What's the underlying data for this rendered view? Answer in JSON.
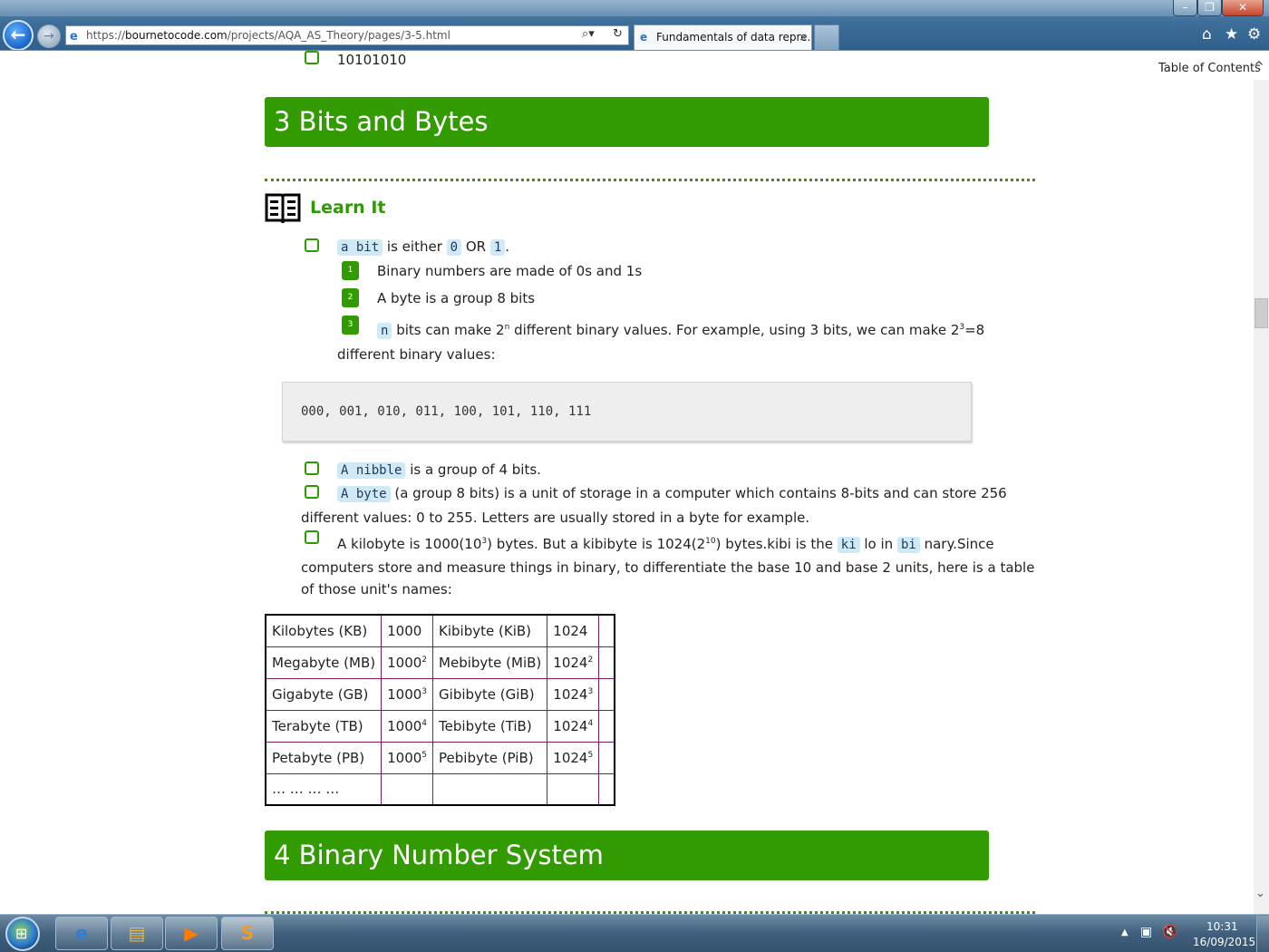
{
  "browser": {
    "url_prefix": "https://",
    "url_host": "bournetocode.com",
    "url_path": "/projects/AQA_AS_Theory/pages/3-5.html",
    "tab_title": "Fundamentals of data repre...",
    "tab_close": "×"
  },
  "page": {
    "toc_link": "Table of Contents",
    "prev_item": "10101010",
    "section3_title": "3 Bits and Bytes",
    "learn_title": "Learn It",
    "bit": {
      "code_bit": "a bit",
      "text_is_either": " is either ",
      "code_zero": "0",
      "text_or": " OR ",
      "code_one": "1",
      "text_dot": "."
    },
    "numbered": [
      {
        "badge": "1",
        "text": "Binary numbers are made of 0s and 1s"
      },
      {
        "badge": "2",
        "text": "A byte is a group 8 bits"
      },
      {
        "badge": "3",
        "code": "n",
        "text_a": " bits can make 2",
        "sup_n": "n",
        "text_b": " different binary values. For example, using 3 bits, we can make 2",
        "sup_3": "3",
        "text_c": "=8",
        "text_d": "different binary values:"
      }
    ],
    "code_block": "000, 001, 010, 011, 100, 101, 110, 111",
    "nibble": {
      "code": "A nibble",
      "text": " is a group of 4 bits."
    },
    "byte": {
      "code": "A byte",
      "text_a": " (a group 8 bits) is a unit of storage in a computer which contains 8-bits and can store 256",
      "text_b": "different values: 0 to 255. Letters are usually stored in a byte for example."
    },
    "kilobyte": {
      "text_a": "A kilobyte is 1000(10",
      "sup_a": "3",
      "text_b": ") bytes. But a kibibyte is 1024(2",
      "sup_b": "10",
      "text_c": ") bytes.kibi is the ",
      "code_ki": "ki",
      "text_d": " lo in ",
      "code_bi": "bi",
      "text_e": " nary.Since",
      "line2": "computers store and measure things in binary, to differentiate the base 10 and base 2 units, here is a table",
      "line3": "of those unit's names:"
    },
    "table_rows": [
      [
        "Kilobytes (KB)",
        "1000",
        "",
        "Kibibyte (KiB)",
        "1024",
        ""
      ],
      [
        "Megabyte (MB)",
        "1000",
        "2",
        "Mebibyte (MiB)",
        "1024",
        "2"
      ],
      [
        "Gigabyte (GB)",
        "1000",
        "3",
        "Gibibyte (GiB)",
        "1024",
        "3"
      ],
      [
        "Terabyte (TB)",
        "1000",
        "4",
        "Tebibyte (TiB)",
        "1024",
        "4"
      ],
      [
        "Petabyte (PB)",
        "1000",
        "5",
        "Pebibyte (PiB)",
        "1024",
        "5"
      ],
      [
        "… … … …",
        "",
        "",
        "",
        "",
        ""
      ]
    ],
    "section4_title": "4 Binary Number System"
  },
  "taskbar": {
    "clock_time": "10:31",
    "clock_date": "16/09/2015",
    "pinned": [
      "internet-explorer",
      "windows-explorer",
      "media-player",
      "sublime-text"
    ]
  },
  "colors": {
    "accent_green": "#329b02",
    "code_bg": "#cfe9f7",
    "table_border": "#7d1f66"
  }
}
